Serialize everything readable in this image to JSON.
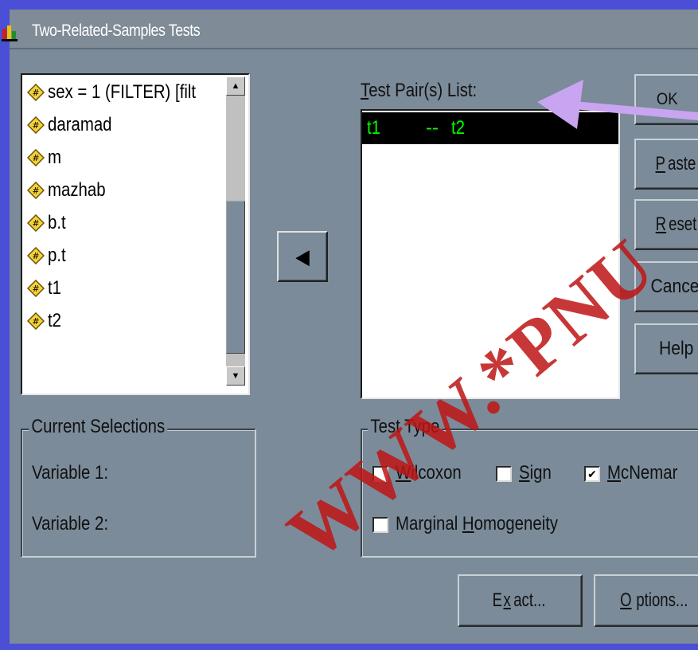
{
  "window": {
    "title": "Two-Related-Samples Tests"
  },
  "variables": [
    "sex = 1 (FILTER) [filt",
    "daramad",
    "m",
    "mazhab",
    "b.t",
    "p.t",
    "t1",
    "t2"
  ],
  "move_button": {
    "glyph": "◀"
  },
  "pairs": {
    "label_prefix": "T",
    "label_rest": "est Pair(s) List:",
    "items": [
      {
        "var1": "t1",
        "sep": "--",
        "var2": "t2"
      }
    ]
  },
  "buttons": {
    "ok": "OK",
    "paste_u": "P",
    "paste_rest": "aste",
    "reset_u": "R",
    "reset_rest": "eset",
    "cancel": "Cancel",
    "help": "Help",
    "exact_pre": "E",
    "exact_u": "x",
    "exact_rest": "act...",
    "options_u": "O",
    "options_rest": "ptions..."
  },
  "current_selections": {
    "title": "Current Selections",
    "var1_label": "Variable 1:",
    "var2_label": "Variable 2:"
  },
  "test_type": {
    "title": "Test Type",
    "wilcoxon_u": "W",
    "wilcoxon_rest": "ilcoxon",
    "wilcoxon_checked": false,
    "sign_u": "S",
    "sign_rest": "ign",
    "sign_checked": false,
    "mcnemar_u": "M",
    "mcnemar_rest": "cNemar",
    "mcnemar_checked": true,
    "marginal_pre": "Marginal ",
    "marginal_u": "H",
    "marginal_rest": "omogeneity",
    "marginal_checked": false
  },
  "watermark": "WWW.*PNU",
  "colors": {
    "background": "#4a4fd6",
    "dialog": "#7b8b99",
    "selection": "#000000",
    "selection_text": "#00ff00",
    "arrow": "#c9a4f0",
    "watermark": "#be1414"
  }
}
